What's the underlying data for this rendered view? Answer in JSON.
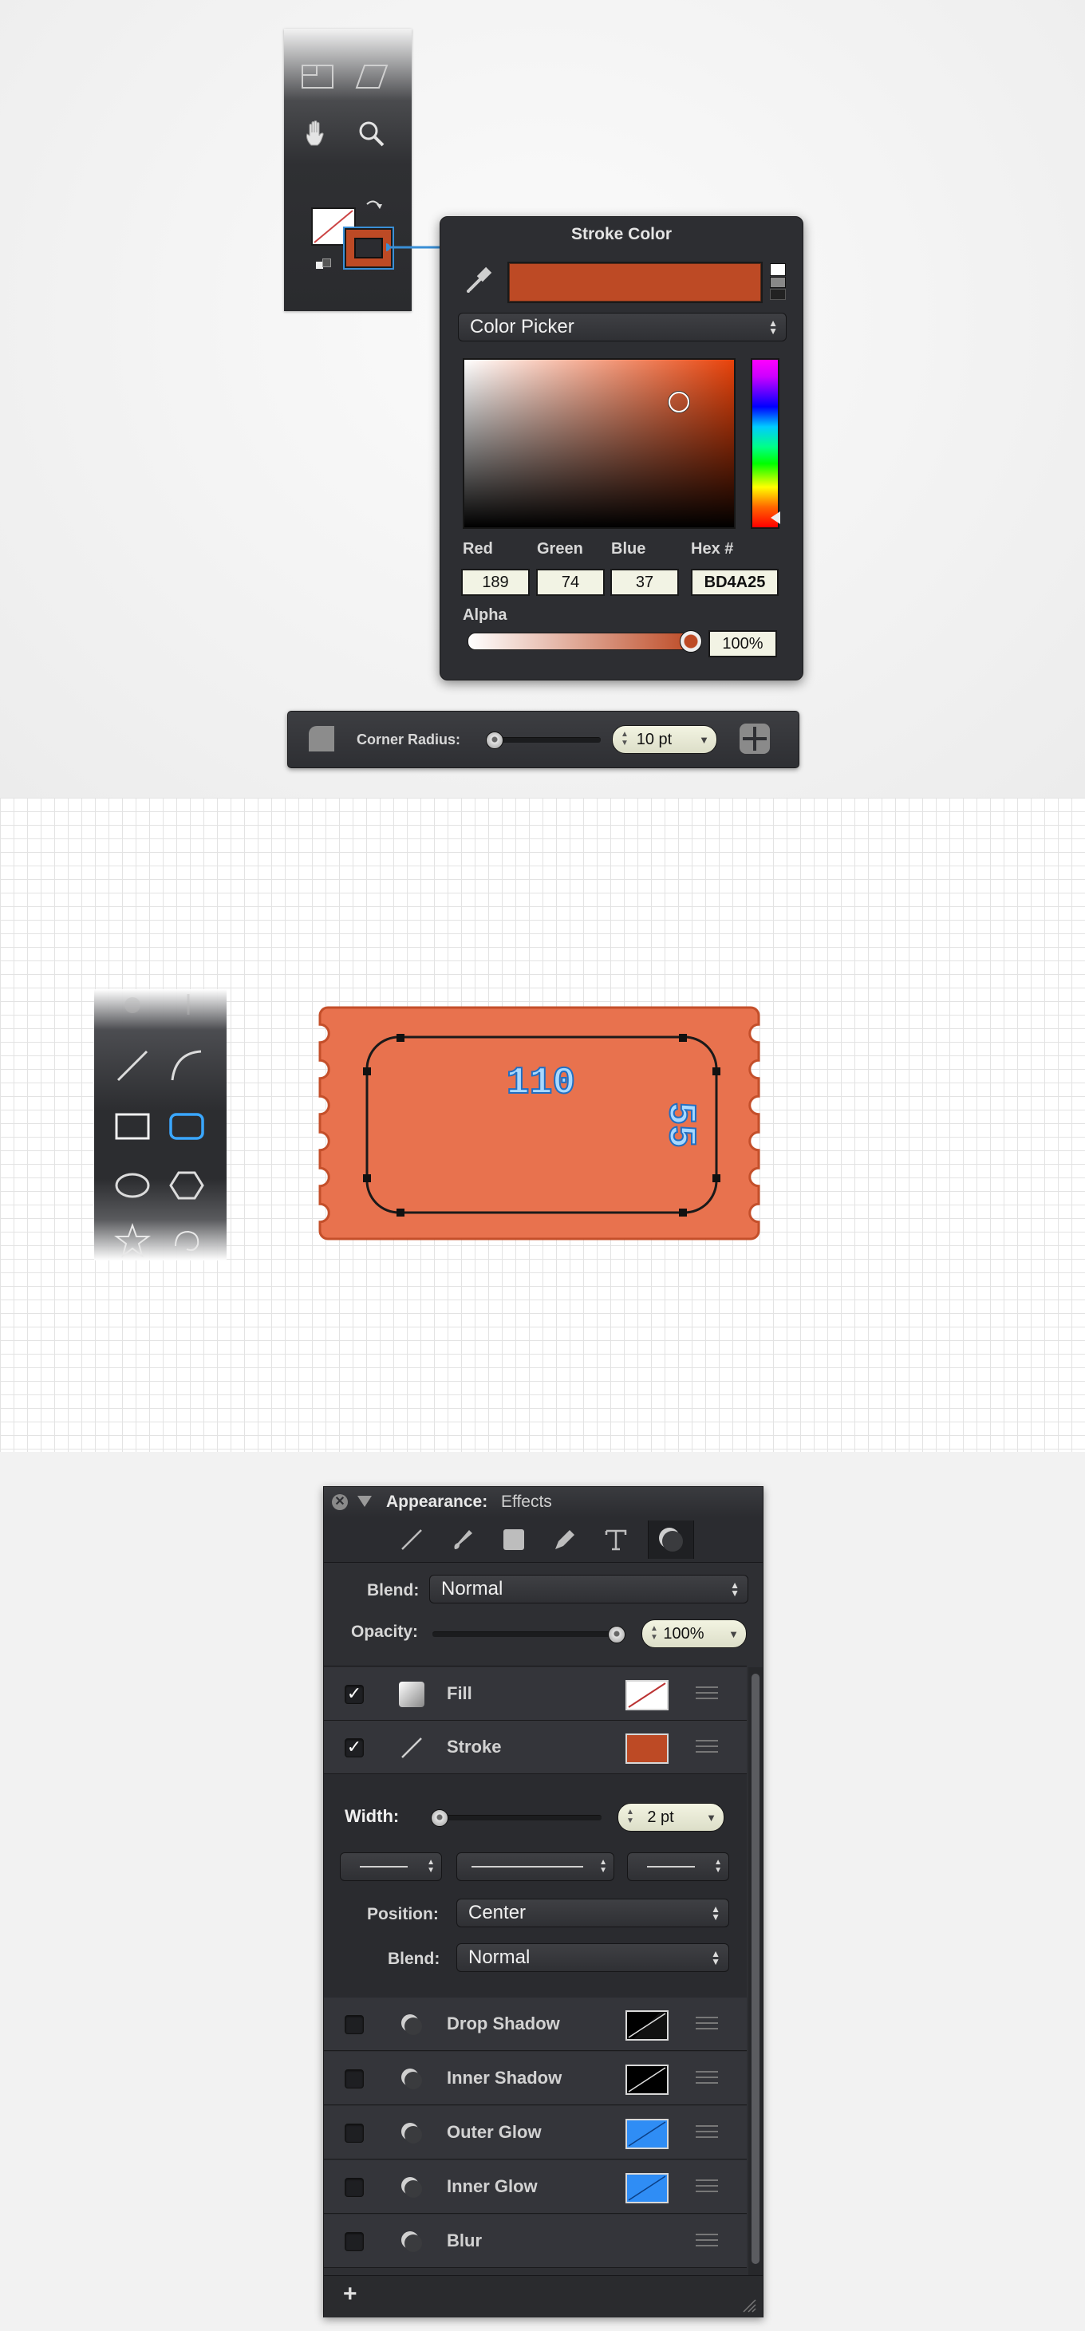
{
  "stroke_popover": {
    "title": "Stroke Color",
    "mode_select": "Color Picker",
    "fields": [
      {
        "label": "Red",
        "value": "189"
      },
      {
        "label": "Green",
        "value": "74"
      },
      {
        "label": "Blue",
        "value": "37"
      },
      {
        "label": "Hex #",
        "value": "BD4A25"
      }
    ],
    "alpha_label": "Alpha",
    "alpha_value": "100%",
    "swatch_color": "#bd4a25"
  },
  "corner_toolbar": {
    "label": "Corner Radius:",
    "value": "10 pt"
  },
  "canvas": {
    "ticket_fill": "#e8724e",
    "ticket_stroke": "#c44f2a",
    "width_label": "110",
    "height_label": "55"
  },
  "appearance": {
    "title": "Appearance:",
    "subtitle": "Effects",
    "blend_label": "Blend:",
    "blend_value": "Normal",
    "opacity_label": "Opacity:",
    "opacity_value": "100%",
    "fill_label": "Fill",
    "stroke_label": "Stroke",
    "stroke_color": "#bd4a25",
    "width_label": "Width:",
    "width_value": "2 pt",
    "position_label": "Position:",
    "position_value": "Center",
    "blend2_label": "Blend:",
    "blend2_value": "Normal",
    "effects": [
      {
        "name": "Drop Shadow",
        "swatch": "black"
      },
      {
        "name": "Inner Shadow",
        "swatch": "black"
      },
      {
        "name": "Outer Glow",
        "swatch": "blue"
      },
      {
        "name": "Inner Glow",
        "swatch": "blue"
      },
      {
        "name": "Blur",
        "swatch": "none"
      }
    ],
    "add_label": "+"
  }
}
